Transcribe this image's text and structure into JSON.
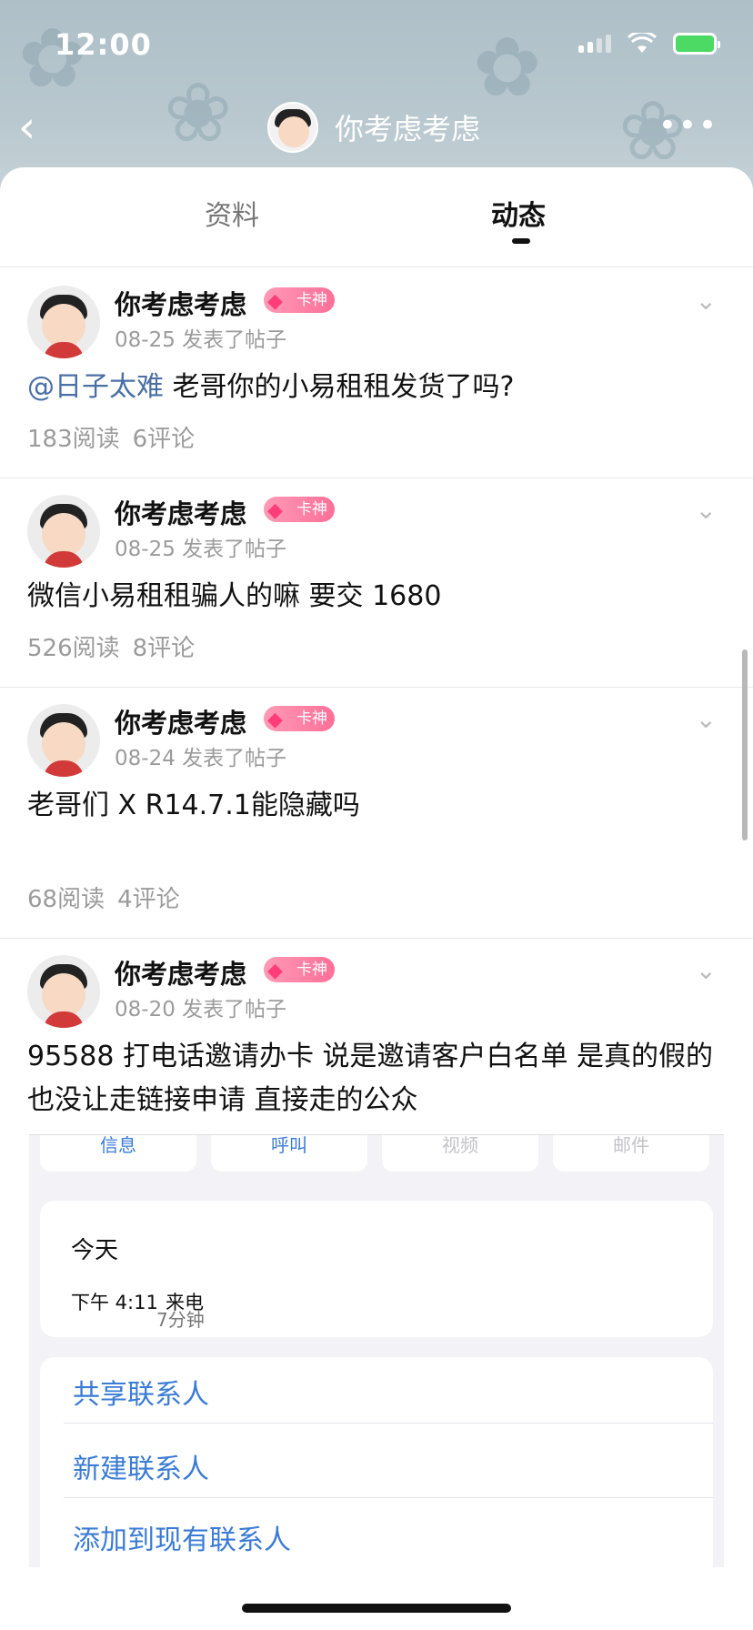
{
  "status_bar": {
    "time": "12:00"
  },
  "header": {
    "title": "你考虑考虑"
  },
  "tabs": [
    {
      "label": "资料",
      "active": false
    },
    {
      "label": "动态",
      "active": true
    }
  ],
  "posts": [
    {
      "author": "你考虑考虑",
      "badge": "卡神",
      "date": "08-25",
      "action": "发表了帖子",
      "mention": "@日子太难",
      "text": " 老哥你的小易租租发货了吗?",
      "reads": "183阅读",
      "comments": "6评论"
    },
    {
      "author": "你考虑考虑",
      "badge": "卡神",
      "date": "08-25",
      "action": "发表了帖子",
      "text": "微信小易租租骗人的嘛 要交 1680",
      "reads": "526阅读",
      "comments": "8评论"
    },
    {
      "author": "你考虑考虑",
      "badge": "卡神",
      "date": "08-24",
      "action": "发表了帖子",
      "text": "老哥们 X R14.7.1能隐藏吗",
      "reads": "68阅读",
      "comments": "4评论"
    },
    {
      "author": "你考虑考虑",
      "badge": "卡神",
      "date": "08-20",
      "action": "发表了帖子",
      "text": "95588 打电话邀请办卡 说是邀请客户白名单 是真的假的 也没让走链接申请 直接走的公众"
    }
  ],
  "embedded_screenshot": {
    "buttons": [
      "信息",
      "呼叫",
      "视频",
      "邮件"
    ],
    "call_day": "今天",
    "call_time": "下午 4:11",
    "call_type": "来电",
    "call_duration": "7分钟",
    "list_items": [
      "共享联系人",
      "新建联系人",
      "添加到现有联系人"
    ]
  },
  "colors": {
    "accent_blue": "#3a7bd5",
    "mention": "#4a6fa5",
    "badge_pink": "#ff6f98"
  }
}
